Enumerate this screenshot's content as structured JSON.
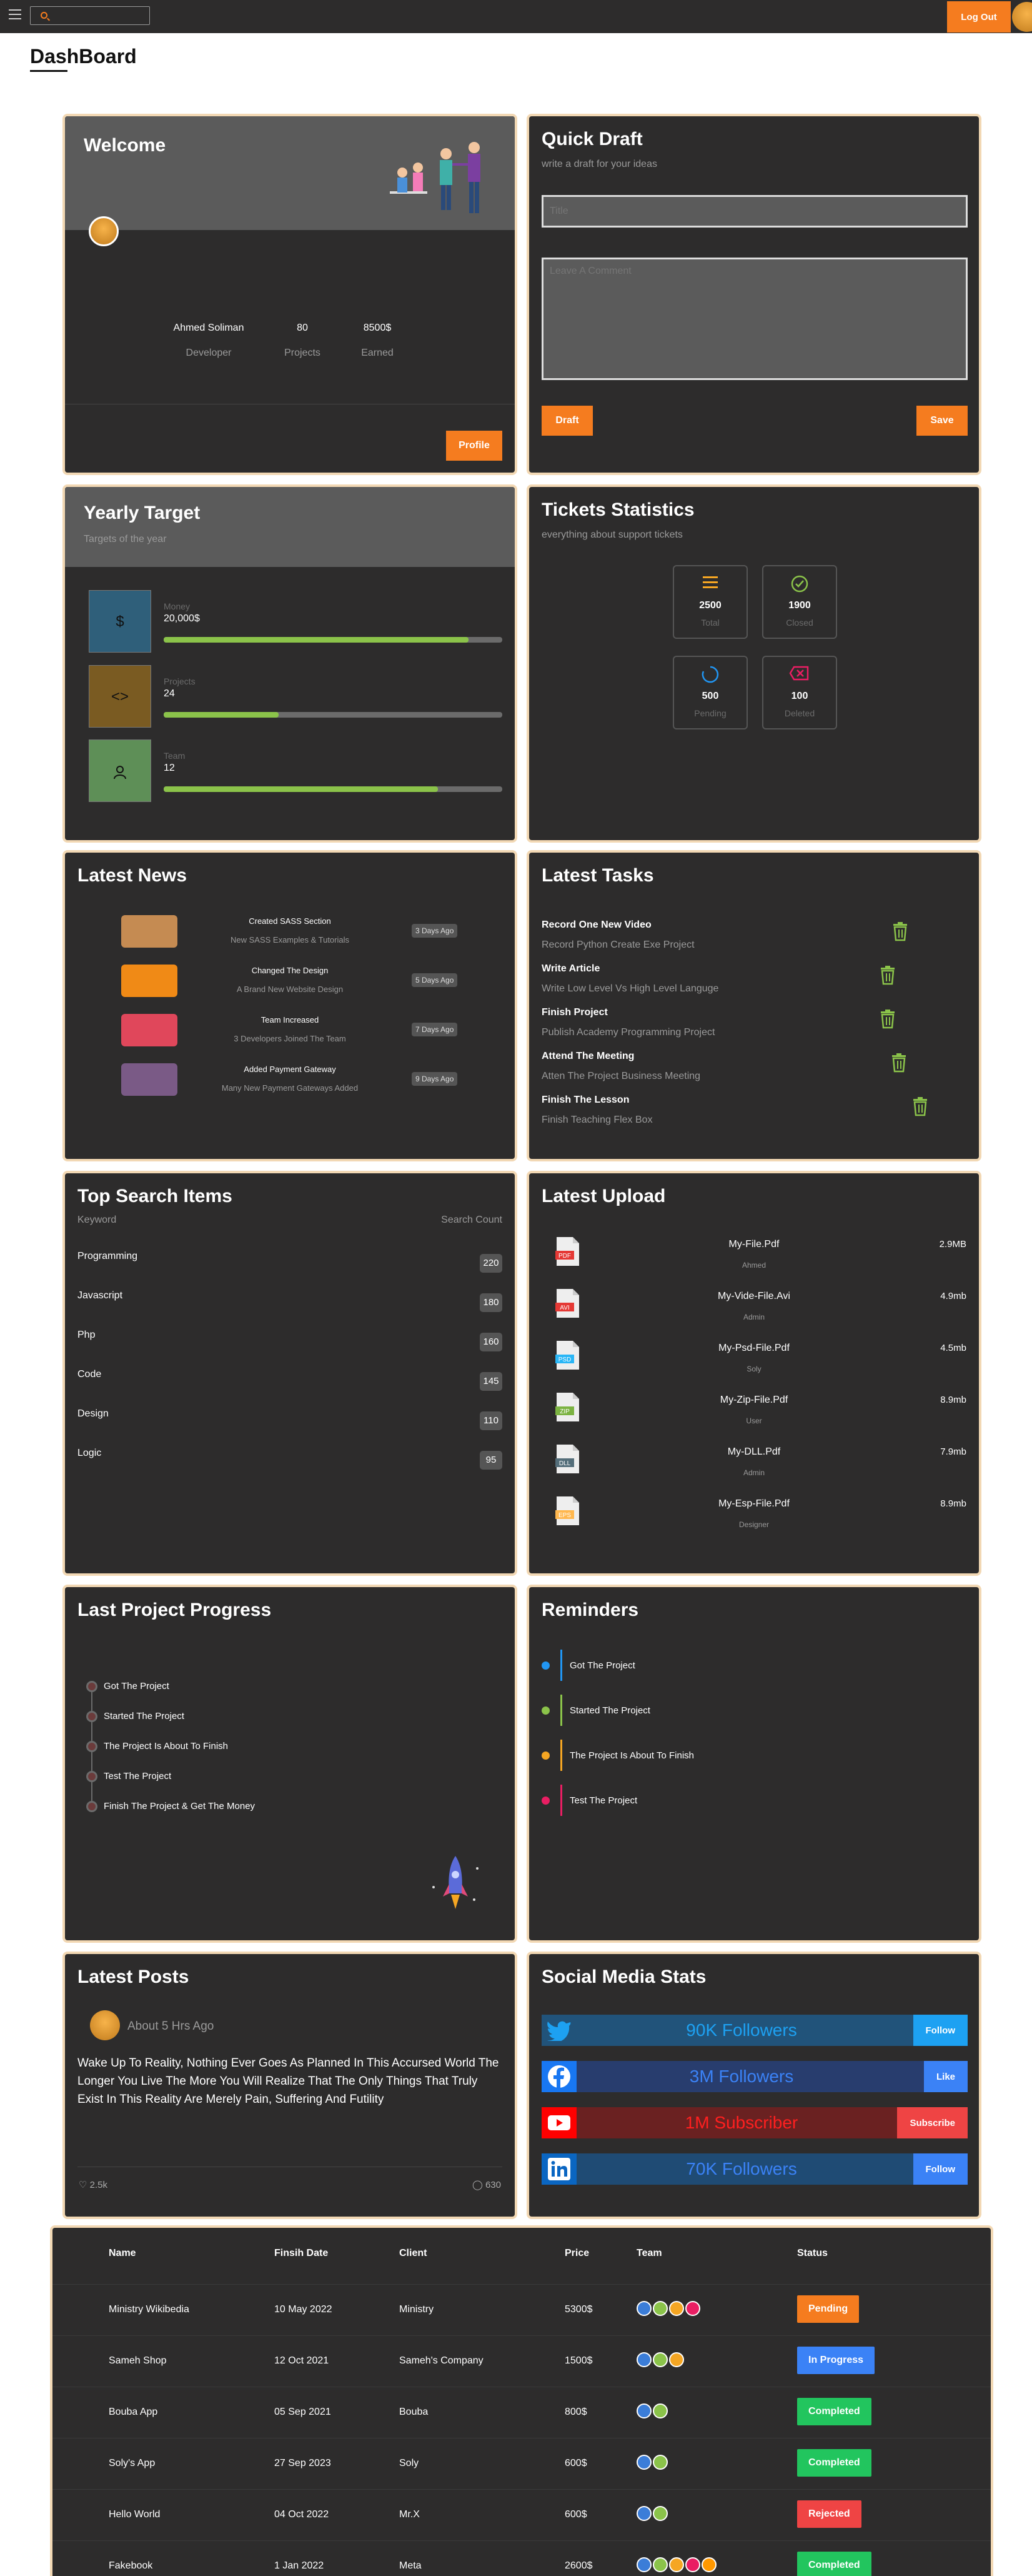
{
  "topbar": {
    "search_placeholder": "",
    "logout_label": "Log Out"
  },
  "page": {
    "title": "DashBoard"
  },
  "welcome": {
    "title": "Welcome",
    "name": "Ahmed Soliman",
    "role": "Developer",
    "projects_value": "80",
    "projects_label": "Projects",
    "earned_value": "8500$",
    "earned_label": "Earned",
    "profile_label": "Profile"
  },
  "draft": {
    "title": "Quick Draft",
    "subtitle": "write a draft for your ideas",
    "title_placeholder": "Title",
    "content_placeholder": "Leave A Comment",
    "draft_label": "Draft",
    "save_label": "Save"
  },
  "yearly": {
    "title": "Yearly Target",
    "subtitle": "Targets of the year",
    "items": [
      {
        "label": "Money",
        "value": "20,000$",
        "percent": 90,
        "icon": "dollar-icon",
        "glyph": "$",
        "color": "#2f5f7a"
      },
      {
        "label": "Projects",
        "value": "24",
        "percent": 34,
        "icon": "code-icon",
        "glyph": "<>",
        "color": "#7a5b22"
      },
      {
        "label": "Team",
        "value": "12",
        "percent": 81,
        "icon": "user-icon",
        "glyph": "",
        "color": "#5e8f57"
      }
    ]
  },
  "tickets": {
    "title": "Tickets Statistics",
    "subtitle": "everything about support tickets",
    "items": [
      {
        "value": "2500",
        "label": "Total",
        "icon": "list-icon",
        "color": "#f5a623"
      },
      {
        "value": "1900",
        "label": "Closed",
        "icon": "check-circle-icon",
        "color": "#8bc34a"
      },
      {
        "value": "500",
        "label": "Pending",
        "icon": "spinner-icon",
        "color": "#2196f3"
      },
      {
        "value": "100",
        "label": "Deleted",
        "icon": "close-rect-icon",
        "color": "#e91e63"
      }
    ]
  },
  "news": {
    "title": "Latest News",
    "items": [
      {
        "title": "Created SASS Section",
        "desc": "New SASS Examples & Tutorials",
        "badge": "3 Days Ago",
        "color": "#c58b52"
      },
      {
        "title": "Changed The Design",
        "desc": "A Brand New Website Design",
        "badge": "5 Days Ago",
        "color": "#f08a16"
      },
      {
        "title": "Team Increased",
        "desc": "3 Developers Joined The Team",
        "badge": "7 Days Ago",
        "color": "#e0475b"
      },
      {
        "title": "Added Payment Gateway",
        "desc": "Many New Payment Gateways Added",
        "badge": "9 Days Ago",
        "color": "#7a5a86"
      }
    ]
  },
  "tasks": {
    "title": "Latest Tasks",
    "items": [
      {
        "title": "Record One New Video",
        "desc": "Record Python Create Exe Project"
      },
      {
        "title": "Write Article",
        "desc": "Write Low Level Vs High Level Languge"
      },
      {
        "title": "Finish Project",
        "desc": "Publish Academy Programming Project"
      },
      {
        "title": "Attend The Meeting",
        "desc": "Atten The Project Business Meeting"
      },
      {
        "title": "Finish The Lesson",
        "desc": "Finish Teaching Flex Box"
      }
    ]
  },
  "search_items": {
    "title": "Top Search Items",
    "col_keyword": "Keyword",
    "col_count": "Search Count",
    "items": [
      {
        "keyword": "Programming",
        "count": "220"
      },
      {
        "keyword": "Javascript",
        "count": "180"
      },
      {
        "keyword": "Php",
        "count": "160"
      },
      {
        "keyword": "Code",
        "count": "145"
      },
      {
        "keyword": "Design",
        "count": "110"
      },
      {
        "keyword": "Logic",
        "count": "95"
      }
    ]
  },
  "uploads": {
    "title": "Latest Upload",
    "items": [
      {
        "file": "My-File.Pdf",
        "user": "Ahmed",
        "size": "2.9MB",
        "ext": "PDF",
        "color": "#e53935"
      },
      {
        "file": "My-Vide-File.Avi",
        "user": "Admin",
        "size": "4.9mb",
        "ext": "AVI",
        "color": "#e53935"
      },
      {
        "file": "My-Psd-File.Pdf",
        "user": "Soly",
        "size": "4.5mb",
        "ext": "PSD",
        "color": "#29b6f6"
      },
      {
        "file": "My-Zip-File.Pdf",
        "user": "User",
        "size": "8.9mb",
        "ext": "ZIP",
        "color": "#7cb342"
      },
      {
        "file": "My-DLL.Pdf",
        "user": "Admin",
        "size": "7.9mb",
        "ext": "DLL",
        "color": "#546e7a"
      },
      {
        "file": "My-Esp-File.Pdf",
        "user": "Designer",
        "size": "8.9mb",
        "ext": "EPS",
        "color": "#ffb74d"
      }
    ]
  },
  "progress": {
    "title": "Last Project Progress",
    "items": [
      "Got The Project",
      "Started The Project",
      "The Project Is About To Finish",
      "Test The Project",
      "Finish The Project & Get The Money"
    ]
  },
  "reminders": {
    "title": "Reminders",
    "items": [
      {
        "text": "Got The Project",
        "color": "#2196f3"
      },
      {
        "text": "Started The Project",
        "color": "#8bc34a"
      },
      {
        "text": "The Project Is About To Finish",
        "color": "#f5a623"
      },
      {
        "text": "Test The Project",
        "color": "#e91e63"
      }
    ]
  },
  "posts": {
    "title": "Latest Posts",
    "time": "About 5 Hrs Ago",
    "body": "Wake Up To Reality, Nothing Ever Goes As Planned In This Accursed World The Longer You Live The More You Will Realize That The Only Things That Truly Exist In This Reality Are Merely Pain, Suffering And Futility",
    "likes": "2.5k",
    "comments": "630"
  },
  "social": {
    "title": "Social Media Stats",
    "items": [
      {
        "icon": "twitter-icon",
        "text": "90K Followers",
        "button": "Follow",
        "bar_color": "#21537a",
        "icon_bg": "#1da1f2",
        "btn_color": "#1da1f2",
        "text_color": "#1da1f2"
      },
      {
        "icon": "facebook-icon",
        "text": "3M Followers",
        "button": "Like",
        "bar_color": "#283d6e",
        "icon_bg": "#1877f2",
        "btn_color": "#3b82f6",
        "text_color": "#3b82f6"
      },
      {
        "icon": "youtube-icon",
        "text": "1M Subscriber",
        "button": "Subscribe",
        "bar_color": "#6a2121",
        "icon_bg": "#ff0000",
        "btn_color": "#ef4444",
        "text_color": "#ff1f1f"
      },
      {
        "icon": "linkedin-icon",
        "text": "70K Followers",
        "button": "Follow",
        "bar_color": "#1f4b74",
        "icon_bg": "#0a66c2",
        "btn_color": "#3b82f6",
        "text_color": "#3b82f6"
      }
    ]
  },
  "projects_table": {
    "headers": [
      "Name",
      "Finsih Date",
      "Client",
      "Price",
      "Team",
      "Status"
    ],
    "rows": [
      {
        "name": "Ministry Wikibedia",
        "date": "10 May 2022",
        "client": "Ministry",
        "price": "5300$",
        "team": 4,
        "status": "Pending",
        "status_color": "#f57c1f"
      },
      {
        "name": "Sameh Shop",
        "date": "12 Oct 2021",
        "client": "Sameh's Company",
        "price": "1500$",
        "team": 3,
        "status": "In Progress",
        "status_color": "#3b82f6"
      },
      {
        "name": "Bouba App",
        "date": "05 Sep 2021",
        "client": "Bouba",
        "price": "800$",
        "team": 2,
        "status": "Completed",
        "status_color": "#22c55e"
      },
      {
        "name": "Soly's App",
        "date": "27 Sep 2023",
        "client": "Soly",
        "price": "600$",
        "team": 2,
        "status": "Completed",
        "status_color": "#22c55e"
      },
      {
        "name": "Hello World",
        "date": "04 Oct 2022",
        "client": "Mr.X",
        "price": "600$",
        "team": 2,
        "status": "Rejected",
        "status_color": "#ef4444"
      },
      {
        "name": "Fakebook",
        "date": "1 Jan 2022",
        "client": "Meta",
        "price": "2600$",
        "team": 5,
        "status": "Completed",
        "status_color": "#22c55e"
      }
    ]
  }
}
